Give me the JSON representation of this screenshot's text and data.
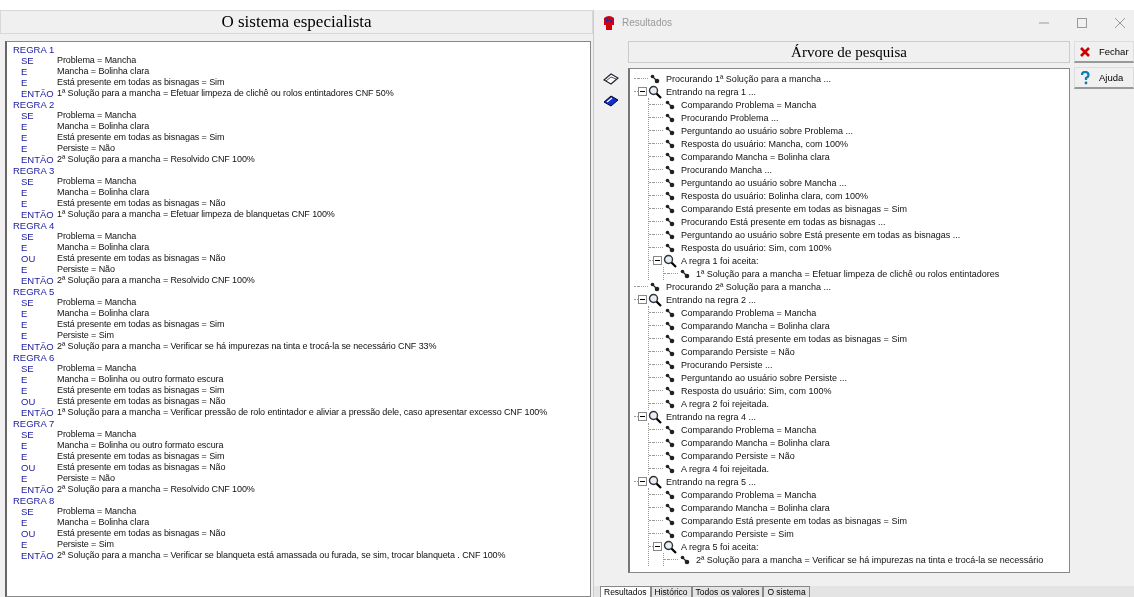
{
  "left_panel": {
    "title": "O sistema especialista",
    "rules": [
      {
        "title": "REGRA 1",
        "clauses": [
          {
            "keyword": "SE",
            "text": "Problema = Mancha"
          },
          {
            "keyword": "E",
            "text": "Mancha = Bolinha clara"
          },
          {
            "keyword": "E",
            "text": "Está presente em todas as bisnagas = Sim"
          },
          {
            "keyword": "ENTÃO",
            "text": "1ª Solução para a mancha = Efetuar limpeza de clichê ou rolos entintadores CNF 50%"
          }
        ]
      },
      {
        "title": "REGRA 2",
        "clauses": [
          {
            "keyword": "SE",
            "text": "Problema = Mancha"
          },
          {
            "keyword": "E",
            "text": "Mancha = Bolinha clara"
          },
          {
            "keyword": "E",
            "text": "Está presente em todas as bisnagas = Sim"
          },
          {
            "keyword": "E",
            "text": "Persiste = Não"
          },
          {
            "keyword": "ENTÃO",
            "text": "2ª Solução para a mancha = Resolvido CNF 100%"
          }
        ]
      },
      {
        "title": "REGRA 3",
        "clauses": [
          {
            "keyword": "SE",
            "text": "Problema = Mancha"
          },
          {
            "keyword": "E",
            "text": "Mancha = Bolinha clara"
          },
          {
            "keyword": "E",
            "text": "Está presente em todas as bisnagas = Não"
          },
          {
            "keyword": "ENTÃO",
            "text": "1ª Solução para a mancha = Efetuar limpeza de blanquetas CNF 100%"
          }
        ]
      },
      {
        "title": "REGRA 4",
        "clauses": [
          {
            "keyword": "SE",
            "text": "Problema = Mancha"
          },
          {
            "keyword": "E",
            "text": "Mancha = Bolinha clara"
          },
          {
            "keyword": "OU",
            "text": "Está presente em todas as bisnagas = Não"
          },
          {
            "keyword": "E",
            "text": "Persiste = Não"
          },
          {
            "keyword": "ENTÃO",
            "text": "2ª Solução para a mancha = Resolvido CNF 100%"
          }
        ]
      },
      {
        "title": "REGRA 5",
        "clauses": [
          {
            "keyword": "SE",
            "text": "Problema = Mancha"
          },
          {
            "keyword": "E",
            "text": "Mancha = Bolinha clara"
          },
          {
            "keyword": "E",
            "text": "Está presente em todas as bisnagas = Sim"
          },
          {
            "keyword": "E",
            "text": "Persiste = Sim"
          },
          {
            "keyword": "ENTÃO",
            "text": "2ª Solução para a mancha = Verificar se há impurezas na tinta e trocá-la se necessário CNF 33%"
          }
        ]
      },
      {
        "title": "REGRA 6",
        "clauses": [
          {
            "keyword": "SE",
            "text": "Problema = Mancha"
          },
          {
            "keyword": "E",
            "text": "Mancha = Bolinha ou outro formato escura"
          },
          {
            "keyword": "E",
            "text": "Está presente em todas as bisnagas = Sim"
          },
          {
            "keyword": "OU",
            "text": "Está presente em todas as bisnagas = Não"
          },
          {
            "keyword": "ENTÃO",
            "text": "1ª Solução para a mancha = Verificar pressão de rolo entintador e aliviar a pressão dele, caso apresentar excesso CNF 100%"
          }
        ]
      },
      {
        "title": "REGRA 7",
        "clauses": [
          {
            "keyword": "SE",
            "text": "Problema = Mancha"
          },
          {
            "keyword": "E",
            "text": "Mancha = Bolinha ou outro formato escura"
          },
          {
            "keyword": "E",
            "text": "Está presente em todas as bisnagas = Sim"
          },
          {
            "keyword": "OU",
            "text": "Está presente em todas as bisnagas = Não"
          },
          {
            "keyword": "E",
            "text": "Persiste = Não"
          },
          {
            "keyword": "ENTÃO",
            "text": "2ª Solução para a mancha = Resolvido CNF 100%"
          }
        ]
      },
      {
        "title": "REGRA 8",
        "clauses": [
          {
            "keyword": "SE",
            "text": "Problema = Mancha"
          },
          {
            "keyword": "E",
            "text": "Mancha = Bolinha clara"
          },
          {
            "keyword": "OU",
            "text": "Está presente em todas as bisnagas = Não"
          },
          {
            "keyword": "E",
            "text": "Persiste = Sim"
          },
          {
            "keyword": "ENTÃO",
            "text": "2ª Solução para a mancha = Verificar se blanqueta está amassada ou furada, se sim, trocar blanqueta . CNF 100%"
          }
        ]
      }
    ]
  },
  "window": {
    "title": "Resultados"
  },
  "header": "Árvore de pesquisa",
  "buttons": [
    "Fechar",
    "Ajuda"
  ],
  "tree": [
    {
      "kind": "step",
      "text": "Procurando 1ª Solução para a mancha ..."
    },
    {
      "kind": "rule",
      "text": "Entrando na regra 1 ...",
      "expanded": true,
      "children": [
        {
          "kind": "step",
          "text": "Comparando Problema = Mancha"
        },
        {
          "kind": "step",
          "text": "Procurando Problema ..."
        },
        {
          "kind": "step",
          "text": "Perguntando ao usuário sobre Problema ..."
        },
        {
          "kind": "step",
          "text": "Resposta do usuário: Mancha, com 100%"
        },
        {
          "kind": "step",
          "text": "Comparando Mancha = Bolinha clara"
        },
        {
          "kind": "step",
          "text": "Procurando Mancha ..."
        },
        {
          "kind": "step",
          "text": "Perguntando ao usuário sobre Mancha ..."
        },
        {
          "kind": "step",
          "text": "Resposta do usuário: Bolinha clara, com 100%"
        },
        {
          "kind": "step",
          "text": "Comparando Está presente em todas as bisnagas = Sim"
        },
        {
          "kind": "step",
          "text": "Procurando Está presente em todas as bisnagas ..."
        },
        {
          "kind": "step",
          "text": "Perguntando ao usuário sobre Está presente em todas as bisnagas ..."
        },
        {
          "kind": "step",
          "text": "Resposta do usuário: Sim, com 100%"
        },
        {
          "kind": "rule",
          "text": "A regra 1 foi aceita:",
          "expanded": true,
          "children": [
            {
              "kind": "step",
              "text": "1ª Solução para a mancha = Efetuar limpeza de clichê ou rolos entintadores"
            }
          ]
        }
      ]
    },
    {
      "kind": "step",
      "text": "Procurando 2ª Solução para a mancha ..."
    },
    {
      "kind": "rule",
      "text": "Entrando na regra 2 ...",
      "expanded": true,
      "children": [
        {
          "kind": "step",
          "text": "Comparando Problema = Mancha"
        },
        {
          "kind": "step",
          "text": "Comparando Mancha = Bolinha clara"
        },
        {
          "kind": "step",
          "text": "Comparando Está presente em todas as bisnagas = Sim"
        },
        {
          "kind": "step",
          "text": "Comparando Persiste = Não"
        },
        {
          "kind": "step",
          "text": "Procurando Persiste ..."
        },
        {
          "kind": "step",
          "text": "Perguntando ao usuário sobre Persiste ..."
        },
        {
          "kind": "step",
          "text": "Resposta do usuário: Sim, com 100%"
        },
        {
          "kind": "step",
          "text": "A regra 2 foi rejeitada."
        }
      ]
    },
    {
      "kind": "rule",
      "text": "Entrando na regra 4 ...",
      "expanded": true,
      "children": [
        {
          "kind": "step",
          "text": "Comparando Problema = Mancha"
        },
        {
          "kind": "step",
          "text": "Comparando Mancha = Bolinha clara"
        },
        {
          "kind": "step",
          "text": "Comparando Persiste = Não"
        },
        {
          "kind": "step",
          "text": "A regra 4 foi rejeitada."
        }
      ]
    },
    {
      "kind": "rule",
      "text": "Entrando na regra 5 ...",
      "expanded": true,
      "children": [
        {
          "kind": "step",
          "text": "Comparando Problema = Mancha"
        },
        {
          "kind": "step",
          "text": "Comparando Mancha = Bolinha clara"
        },
        {
          "kind": "step",
          "text": "Comparando Está presente em todas as bisnagas = Sim"
        },
        {
          "kind": "step",
          "text": "Comparando Persiste = Sim"
        },
        {
          "kind": "rule",
          "text": "A regra 5 foi aceita:",
          "expanded": true,
          "children": [
            {
              "kind": "step",
              "text": "2ª Solução para a mancha = Verificar se há impurezas na tinta e trocá-la se necessário"
            }
          ]
        }
      ]
    }
  ],
  "tabs": [
    {
      "label": "Resultados",
      "selected": true
    },
    {
      "label": "Histórico",
      "selected": false
    },
    {
      "label": "Todos os valores",
      "selected": false
    },
    {
      "label": "O sistema",
      "selected": false
    }
  ]
}
